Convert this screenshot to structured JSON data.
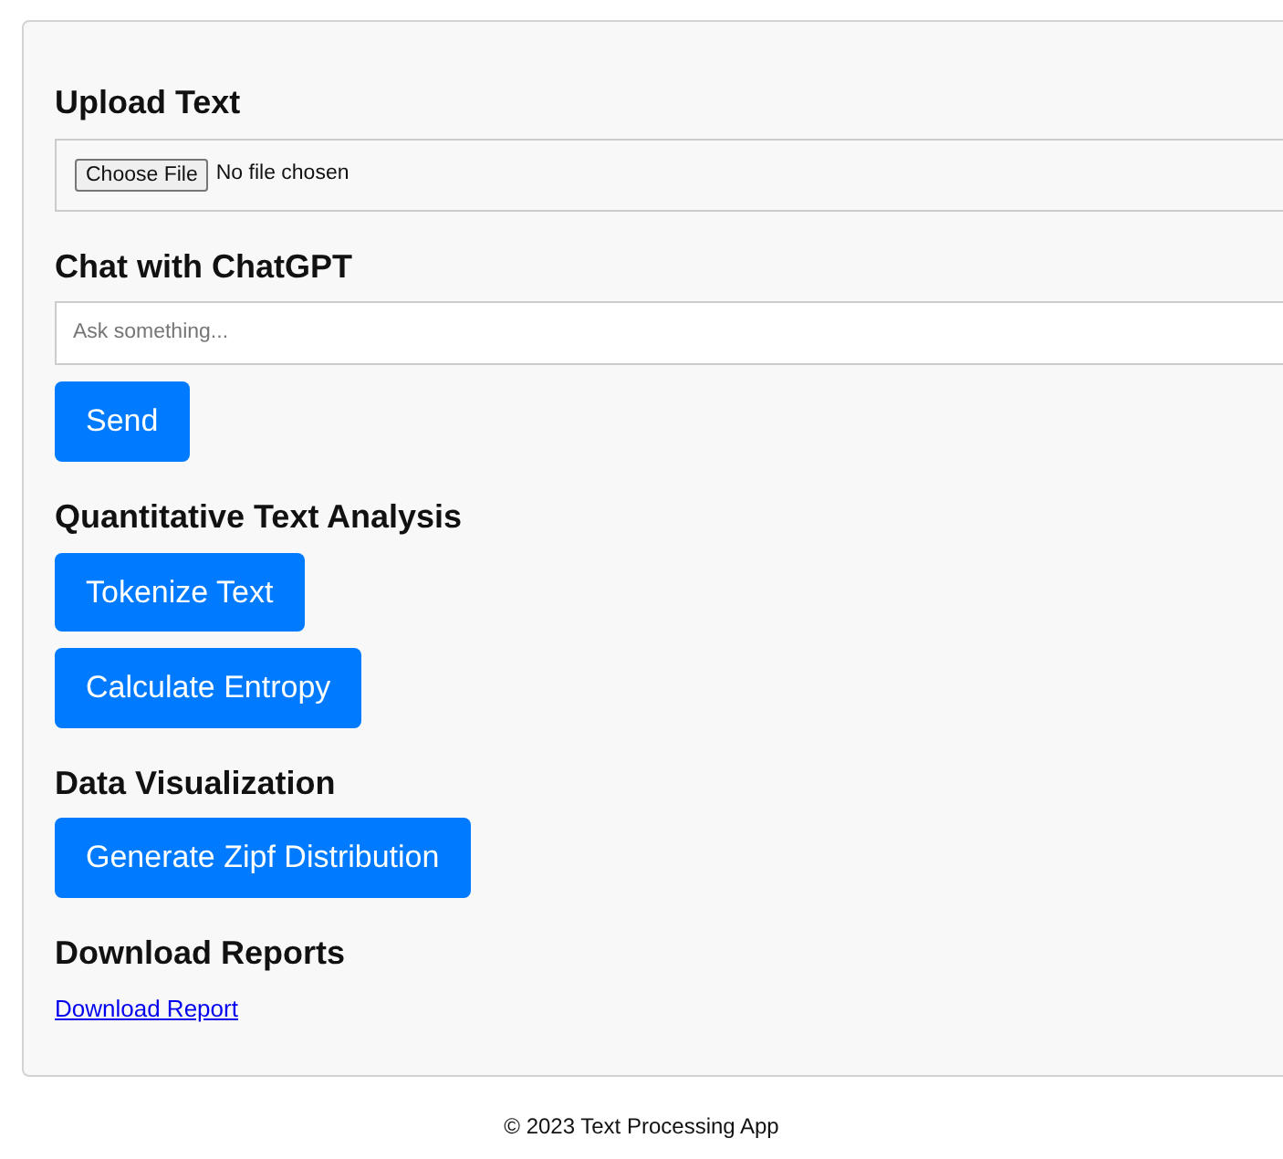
{
  "sections": [
    {
      "heading": "Upload Text",
      "kind": "file",
      "file": {
        "button": "Choose File",
        "status": "No file chosen"
      }
    },
    {
      "heading": "Chat with ChatGPT",
      "kind": "chat",
      "input": {
        "placeholder": "Ask something..."
      },
      "buttons": [
        "Send"
      ]
    },
    {
      "heading": "Quantitative Text Analysis",
      "kind": "buttons",
      "buttons": [
        "Tokenize Text",
        "Calculate Entropy"
      ]
    },
    {
      "heading": "Data Visualization",
      "kind": "buttons",
      "buttons": [
        "Generate Zipf Distribution"
      ]
    },
    {
      "heading": "Download Reports",
      "kind": "link",
      "link": "Download Report"
    }
  ],
  "footer": "© 2023 Text Processing App"
}
